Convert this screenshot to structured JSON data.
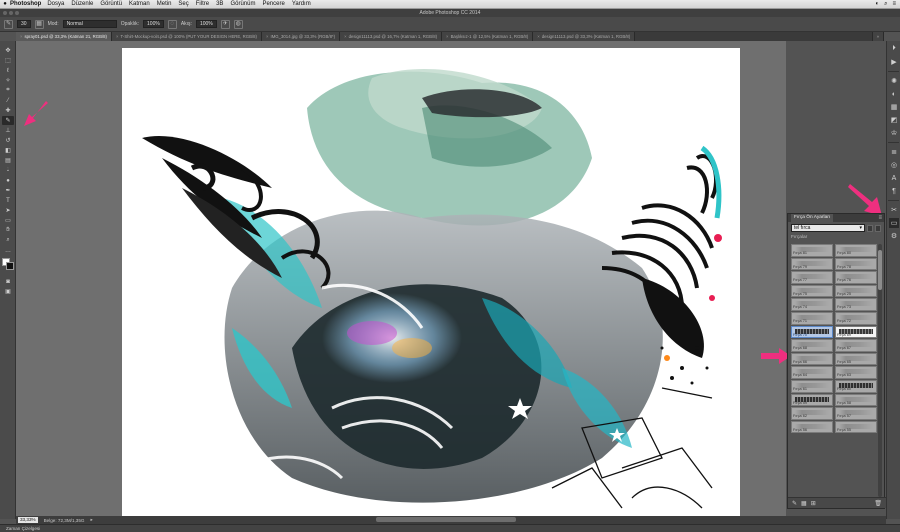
{
  "menubar": {
    "apple_icon": "apple-icon",
    "app_name": "Photoshop",
    "items": [
      "Dosya",
      "Düzenle",
      "Görüntü",
      "Katman",
      "Metin",
      "Seç",
      "Filtre",
      "3B",
      "Görünüm",
      "Pencere",
      "Yardım"
    ]
  },
  "window": {
    "title": "Adobe Photoshop CC 2014"
  },
  "options": {
    "mode_label": "Mod:",
    "mode_value": "Normal",
    "opacity_label": "Opaklık:",
    "opacity_value": "100%",
    "flow_label": "Akış:",
    "flow_value": "100%",
    "brush_size": "30"
  },
  "tabs": [
    {
      "label": "spray01.psd @ 33,3% (Katman 21, RGB/8)",
      "active": true
    },
    {
      "label": "T-Shirt-Mockup-vol4.psd @ 100% (PUT YOUR DESIGN HERE, RGB/8)",
      "active": false
    },
    {
      "label": "IMG_3014.jpg @ 33,3% (RGB/8*)",
      "active": false
    },
    {
      "label": "design11113.psd @ 16,7% (Katman 1, RGB/8)",
      "active": false
    },
    {
      "label": "Başlıksız-1 @ 12,5% (Katman 1, RGB/8)",
      "active": false
    },
    {
      "label": "design11113.psd @ 33,3% (Katman 1, RGB/8)",
      "active": false
    }
  ],
  "tools": [
    "move-tool",
    "marquee-tool",
    "lasso-tool",
    "quick-select-tool",
    "crop-tool",
    "eyedropper-tool",
    "healing-tool",
    "brush-tool",
    "clone-stamp-tool",
    "history-brush-tool",
    "eraser-tool",
    "gradient-tool",
    "blur-tool",
    "dodge-tool",
    "pen-tool",
    "type-tool",
    "path-select-tool",
    "shape-tool",
    "hand-tool",
    "zoom-tool"
  ],
  "active_tool_index": 7,
  "brush_panel": {
    "tab_label": "Fırça Ön Ayarları",
    "preset_value": "tel fırca",
    "section_label": "Fırçalar",
    "brushes": [
      {
        "name": "Fırça 81"
      },
      {
        "name": "Fırça 80"
      },
      {
        "name": "Fırça 79"
      },
      {
        "name": "Fırça 78"
      },
      {
        "name": "Fırça 77"
      },
      {
        "name": "Fırça 76"
      },
      {
        "name": "Fırça 75"
      },
      {
        "name": "Fırça 25"
      },
      {
        "name": "Fırça 74"
      },
      {
        "name": "Fırça 73"
      },
      {
        "name": "Fırça 71"
      },
      {
        "name": "Fırça 72"
      },
      {
        "name": "Fırça 70"
      },
      {
        "name": "Fırça 69"
      },
      {
        "name": "Fırça 68"
      },
      {
        "name": "Fırça 67"
      },
      {
        "name": "Fırça 66"
      },
      {
        "name": "Fırça 65"
      },
      {
        "name": "Fırça 64"
      },
      {
        "name": "Fırça 63"
      },
      {
        "name": "Fırça 61"
      },
      {
        "name": "Fırça 60"
      },
      {
        "name": "Fırça 59"
      },
      {
        "name": "Fırça 58"
      },
      {
        "name": "Fırça 62"
      },
      {
        "name": "Fırça 57"
      },
      {
        "name": "Fırça 56"
      },
      {
        "name": "Fırça 55"
      }
    ],
    "selected_index": 12
  },
  "status": {
    "zoom": "33,33%",
    "doc_info": "Belge: 72,3M/1,35G"
  },
  "timeline_label": "Zaman Çizelgesi",
  "colors": {
    "arrow": "#ee2f7f",
    "panel_selection": "#b4c8e6"
  }
}
